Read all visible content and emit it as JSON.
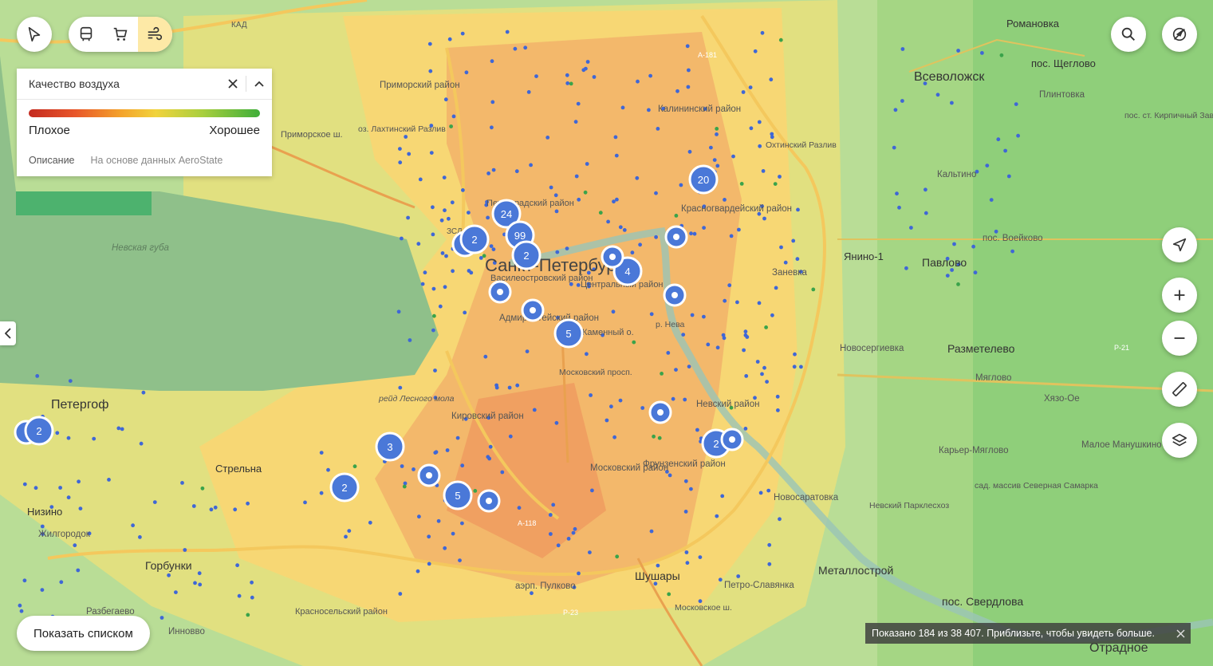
{
  "map": {
    "water_label": "Невская губа",
    "city_label": "Санкт-Петербург",
    "places": [
      "Петергоф",
      "Всеволожск",
      "Романовка",
      "пос. Щеглово",
      "Плинтовка",
      "пос. ст. Кирпичный Завод",
      "Кальтино",
      "пос. Воейково",
      "Янино-1",
      "Павлово",
      "Заневка",
      "Новосергиевка",
      "Разметелево",
      "Мяглово",
      "Хязо-Ое",
      "Карьер-Мяглово",
      "Малое Манушкино",
      "сад. массив Северная Самарка",
      "Невский Парклесхоз",
      "Новосаратовка",
      "Металлострой",
      "пос. Свердлова",
      "Отрадное",
      "Петро-Славянка",
      "Шушары",
      "Горбунки",
      "Красносельский район",
      "Инновво",
      "Стрельна",
      "Низино",
      "Жилгородок",
      "Разбегаево",
      "Приморский район",
      "оз. Лахтинский Разлив",
      "Охтинский Разлив",
      "Красногвардейский район",
      "Калининский район",
      "Невский район",
      "Фрунзенский район",
      "Московский район",
      "Кировский район",
      "Адмиралтейский район",
      "Василеостровский район",
      "Центральный район",
      "Каменный о.",
      "Петроградский район",
      "рейд Лесного мола",
      "аэрп. Пулково",
      "КАД",
      "ЗСД",
      "Приморское ш.",
      "Московское ш.",
      "р. Нева",
      "Московский просп.",
      "A-118",
      "A-181",
      "P-21",
      "P-23"
    ],
    "clusters": [
      "24",
      "2",
      "99",
      "2",
      "4",
      "20",
      "5",
      "2",
      "2",
      "3",
      "5",
      "2"
    ]
  },
  "toolbar": {
    "transport_icon": "bus-icon",
    "shopping_icon": "cart-icon",
    "air_icon": "air-quality-icon",
    "cursor_icon": "cursor-icon",
    "search_icon": "search-icon",
    "traffic_icon": "traffic-off-icon",
    "locate_icon": "locate-icon",
    "zoom_in_icon": "plus-icon",
    "zoom_out_icon": "minus-icon",
    "ruler_icon": "ruler-icon",
    "layers_icon": "layers-icon"
  },
  "air_panel": {
    "title": "Качество воздуха",
    "bad": "Плохое",
    "good": "Хорошее",
    "description_link": "Описание",
    "source_note": "На основе данных AeroState"
  },
  "show_list": "Показать списком",
  "status": "Показано 184 из 38 407. Приблизьте, чтобы увидеть больше."
}
